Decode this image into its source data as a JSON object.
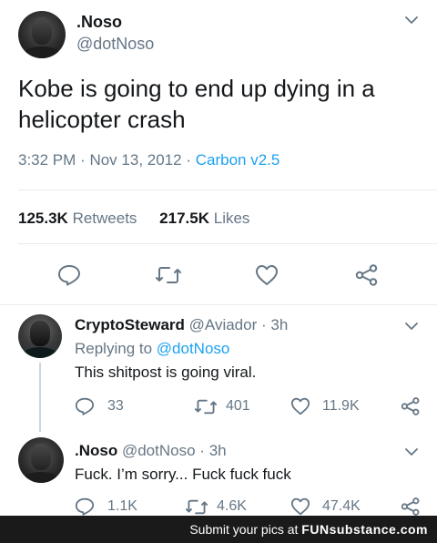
{
  "main_tweet": {
    "display_name": ".Noso",
    "handle": "@dotNoso",
    "text_line1": "Kobe is going to end up dying in a",
    "text_line2": "helicopter crash",
    "time": "3:32 PM",
    "dot1": "·",
    "date": "Nov 13, 2012",
    "dot2": "·",
    "source": "Carbon v2.5",
    "retweets_count": "125.3K",
    "retweets_label": "Retweets",
    "likes_count": "217.5K",
    "likes_label": "Likes"
  },
  "replies": [
    {
      "display_name": "CryptoSteward",
      "handle": "@Aviador",
      "dot": "·",
      "age": "3h",
      "replying_prefix": "Replying to",
      "replying_handle": "@dotNoso",
      "text": "This shitpost is going viral.",
      "reply_count": "33",
      "retweet_count": "401",
      "like_count": "11.9K"
    },
    {
      "display_name": ".Noso",
      "handle": "@dotNoso",
      "dot": "·",
      "age": "3h",
      "text": "Fuck. I’m sorry... Fuck fuck fuck",
      "reply_count": "1.1K",
      "retweet_count": "4.6K",
      "like_count": "47.4K"
    }
  ],
  "banner": {
    "prefix": "Submit your pics at",
    "brand": "FUNsubstance.com"
  },
  "colors": {
    "accent": "#1da1f2",
    "muted": "#657786",
    "text": "#14171a",
    "banner_bg": "#1a1a1a"
  }
}
